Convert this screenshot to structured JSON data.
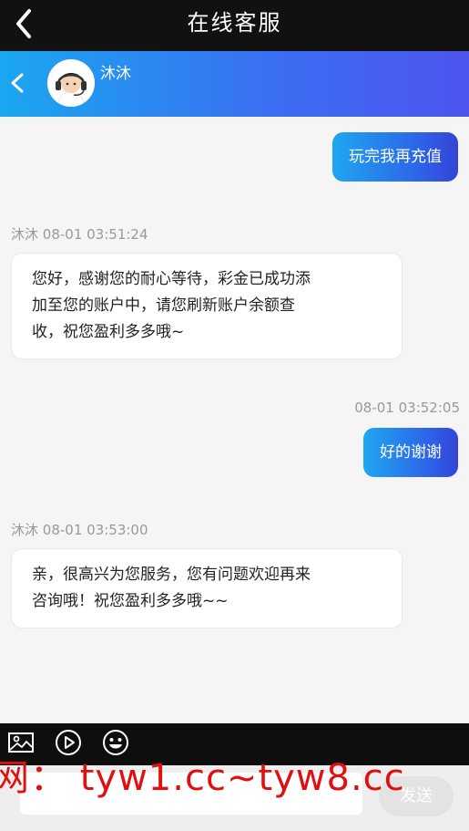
{
  "header": {
    "title": "在线客服"
  },
  "agent": {
    "name": "沐沐"
  },
  "messages": [
    {
      "side": "right",
      "text": "玩完我再充值"
    },
    {
      "side": "left",
      "sender": "沐沐",
      "time": "08-01 03:51:24",
      "lines": [
        "您好，感谢您的耐心等待，彩金已成功添",
        "加至您的账户中，请您刷新账户余额查",
        "收，祝您盈利多多哦~"
      ]
    },
    {
      "side": "right",
      "time": "08-01 03:52:05",
      "text": "好的谢谢"
    },
    {
      "side": "left",
      "sender": "沐沐",
      "time": "08-01 03:53:00",
      "lines": [
        "亲，很高兴为您服务，您有问题欢迎再来",
        "咨询哦！祝您盈利多多哦~~"
      ]
    }
  ],
  "toolbar": {
    "icons": [
      "image-icon",
      "play-icon",
      "emoji-icon"
    ]
  },
  "watermark": "网： tyw1.cc~tyw8.cc",
  "input": {
    "placeholder": "",
    "send_label": "发送"
  },
  "colors": {
    "top_bar": "#111111",
    "gradient_start": "#1aa7f0",
    "gradient_end": "#4d55ee",
    "watermark": "#e01010"
  }
}
